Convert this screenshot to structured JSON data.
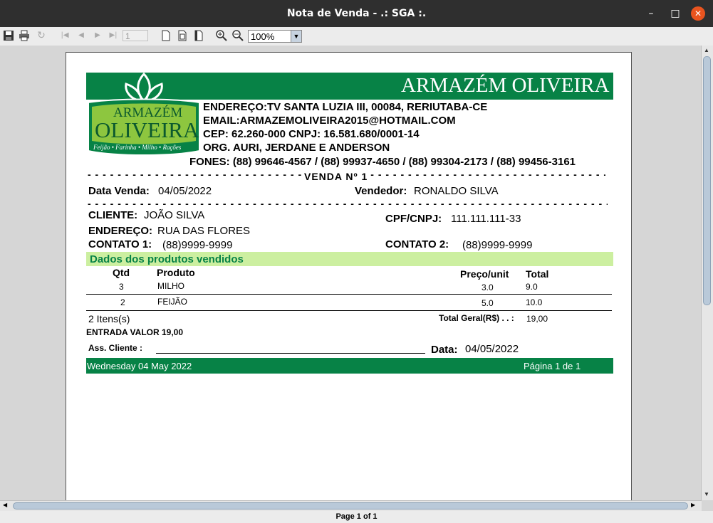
{
  "window": {
    "title": "Nota de Venda - .: SGA :.",
    "min": "–",
    "max": "□",
    "close": "✕"
  },
  "toolbar": {
    "page_input": "1",
    "zoom": "100%"
  },
  "status": {
    "page_label": "Page 1 of 1"
  },
  "receipt": {
    "store_name": "ARMAZÉM OLIVEIRA",
    "logo": {
      "line1": "ARMAZÉM",
      "line2": "OLIVEIRA",
      "line3": "Feijão • Farinha • Milho • Rações"
    },
    "address": "ENDEREÇO:TV SANTA LUZIA III, 00084, RERIUTABA-CE",
    "email": "EMAIL:ARMAZEMOLIVEIRA2015@HOTMAIL.COM",
    "cep_cnpj": "CEP: 62.260-000 CNPJ: 16.581.680/0001-14",
    "org": "ORG. AURI, JERDANE E ANDERSON",
    "phones": "FONES: (88) 99646-4567 / (88) 99937-4650 / (88) 99304-2173 / (88) 99456-3161",
    "sale_title": "VENDA Nº 1",
    "date_label": "Data Venda:",
    "date_value": "04/05/2022",
    "seller_label": "Vendedor:",
    "seller_value": "RONALDO SILVA",
    "client_label": "CLIENTE:",
    "client_value": "JOÃO SILVA",
    "cpf_label": "CPF/CNPJ:",
    "cpf_value": "111.111.111-33",
    "addr_label": "ENDEREÇO:",
    "addr_value": "RUA DAS FLORES",
    "contact1_label": "CONTATO 1:",
    "contact1_value": "(88)9999-9999",
    "contact2_label": "CONTATO 2:",
    "contact2_value": "(88)9999-9999",
    "products_header": "Dados dos produtos vendidos",
    "columns": {
      "qty": "Qtd",
      "product": "Produto",
      "unit_price": "Preço/unit",
      "total": "Total"
    },
    "items": [
      {
        "qty": "3",
        "product": "MILHO",
        "unit_price": "3.0",
        "total": "9.0"
      },
      {
        "qty": "2",
        "product": "FEIJÃO",
        "unit_price": "5.0",
        "total": "10.0"
      }
    ],
    "items_count": "2 Itens(s)",
    "grand_total_label": "Total Geral(R$) . . :",
    "grand_total_value": "19,00",
    "entry": "ENTRADA VALOR 19,00",
    "signature_label": "Ass. Cliente :",
    "sig_date_label": "Data:",
    "sig_date_value": "04/05/2022",
    "footer_date": "Wednesday 04 May 2022",
    "footer_page": "Página 1 de 1"
  },
  "colors": {
    "brand_green": "#078246",
    "header_light_green": "#ccefa0",
    "logo_lime": "#8dc63f"
  }
}
